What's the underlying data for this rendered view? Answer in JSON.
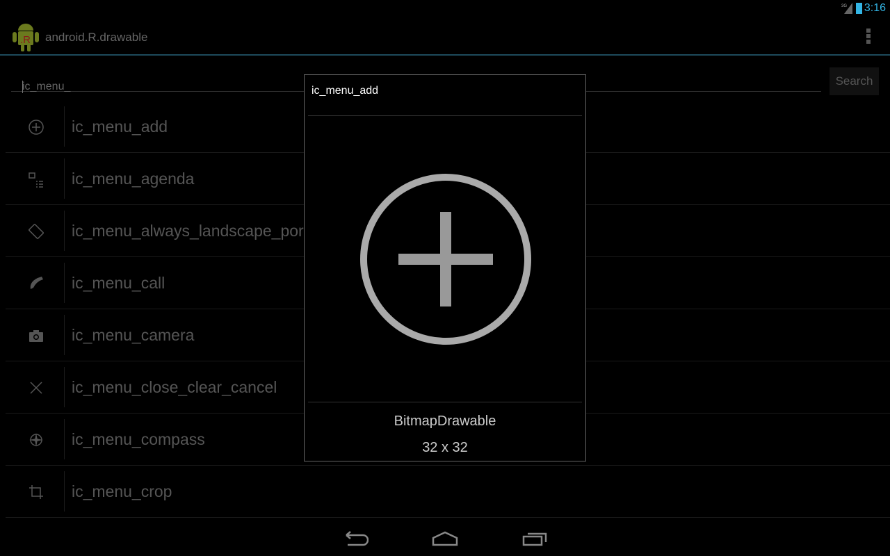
{
  "status": {
    "network": "3G",
    "time": "3:16",
    "accent": "#33b5e5"
  },
  "app": {
    "title": "android.R.drawable",
    "logo_text": ".R"
  },
  "search": {
    "value": "ic_menu_",
    "button": "Search"
  },
  "items": [
    {
      "label": "ic_menu_add",
      "icon": "plus-circle-icon"
    },
    {
      "label": "ic_menu_agenda",
      "icon": "agenda-icon"
    },
    {
      "label": "ic_menu_always_landscape_portrait",
      "icon": "rotate-icon"
    },
    {
      "label": "ic_menu_call",
      "icon": "phone-icon"
    },
    {
      "label": "ic_menu_camera",
      "icon": "camera-icon"
    },
    {
      "label": "ic_menu_close_clear_cancel",
      "icon": "close-icon"
    },
    {
      "label": "ic_menu_compass",
      "icon": "compass-icon"
    },
    {
      "label": "ic_menu_crop",
      "icon": "crop-icon"
    }
  ],
  "dialog": {
    "title": "ic_menu_add",
    "type": "BitmapDrawable",
    "size": "32 x 32"
  }
}
